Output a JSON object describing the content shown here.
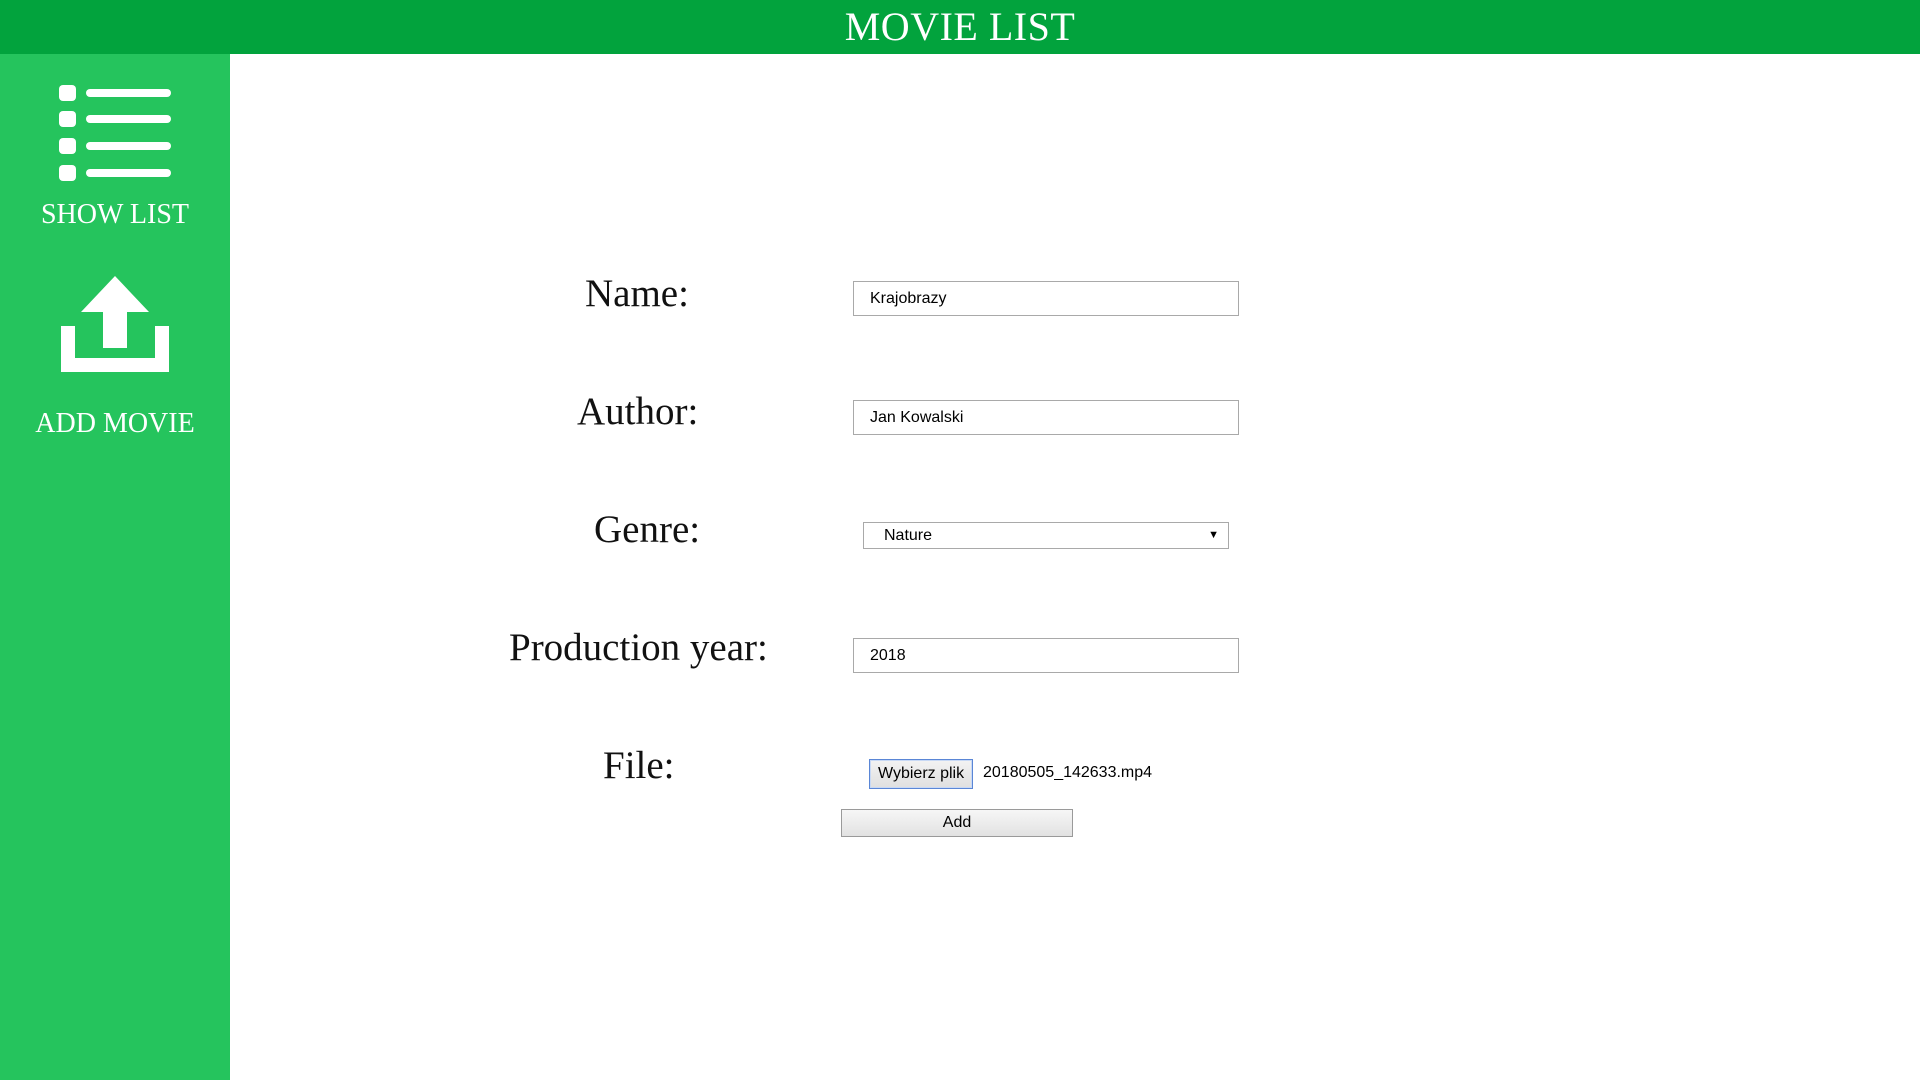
{
  "header": {
    "title": "MOVIE LIST"
  },
  "sidebar": {
    "items": [
      {
        "label": "SHOW LIST",
        "icon": "list-icon"
      },
      {
        "label": "ADD MOVIE",
        "icon": "upload-icon"
      }
    ]
  },
  "form": {
    "name": {
      "label": "Name:",
      "value": "Krajobrazy"
    },
    "author": {
      "label": "Author:",
      "value": "Jan Kowalski"
    },
    "genre": {
      "label": "Genre:",
      "selected": "Nature"
    },
    "year": {
      "label": "Production year:",
      "value": "2018"
    },
    "file": {
      "label": "File:",
      "button_label": "Wybierz plik",
      "file_name": "20180505_142633.mp4"
    },
    "submit_label": "Add"
  },
  "colors": {
    "header_bg": "#02a33d",
    "sidebar_bg": "#25c45d",
    "text": "#111111"
  }
}
